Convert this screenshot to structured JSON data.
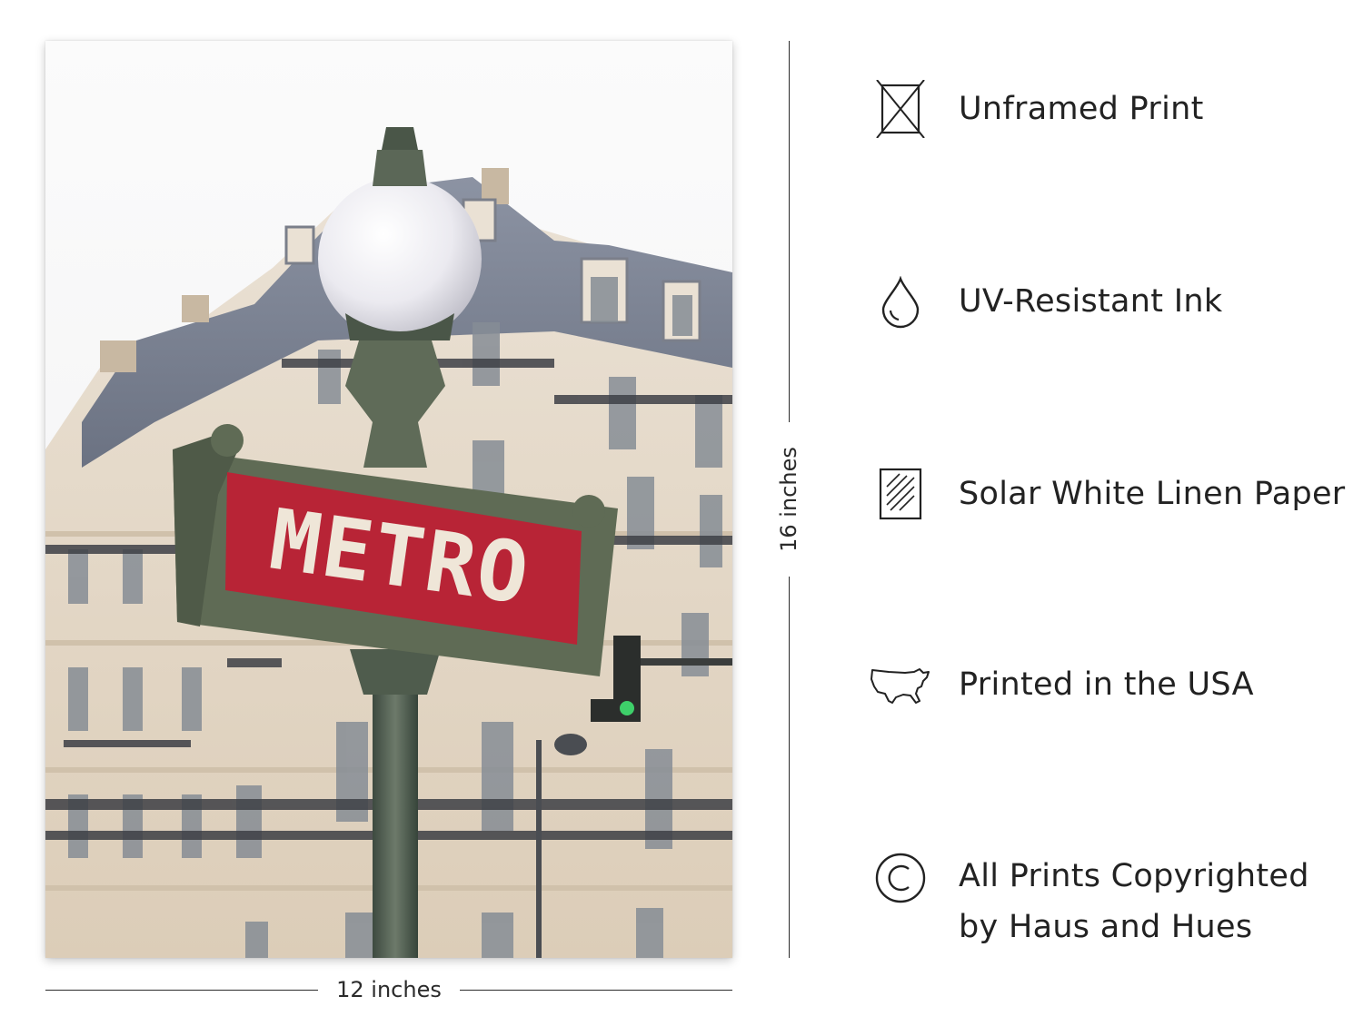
{
  "print": {
    "sign_text": "METRO",
    "width_label": "12 inches",
    "height_label": "16 inches"
  },
  "features": [
    {
      "icon": "unframed-frame-icon",
      "label": "Unframed Print"
    },
    {
      "icon": "ink-drop-icon",
      "label": "UV-Resistant Ink"
    },
    {
      "icon": "linen-paper-icon",
      "label": "Solar White Linen Paper"
    },
    {
      "icon": "usa-map-icon",
      "label": "Printed in the USA"
    },
    {
      "icon": "copyright-icon",
      "label": "All Prints Copyrighted",
      "label_line2": "by Haus and Hues"
    }
  ],
  "colors": {
    "sign_red": "#b82436",
    "sign_green": "#5f6b55",
    "text": "#222222"
  }
}
